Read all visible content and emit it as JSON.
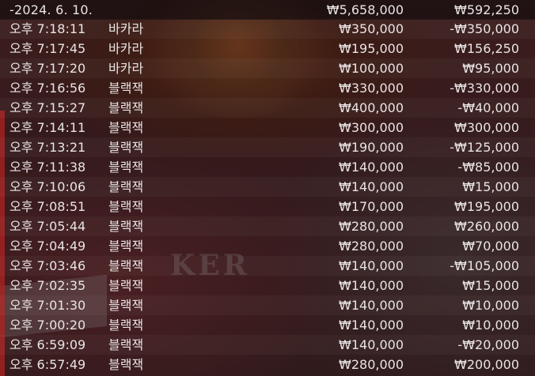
{
  "summary": {
    "date": "-2024. 6. 10.",
    "total_bet": "₩5,658,000",
    "total_result": "₩592,250"
  },
  "rows": [
    {
      "time": "오후 7:18:11",
      "game": "바카라",
      "bet": "₩350,000",
      "result": "-₩350,000"
    },
    {
      "time": "오후 7:17:45",
      "game": "바카라",
      "bet": "₩195,000",
      "result": "₩156,250"
    },
    {
      "time": "오후 7:17:20",
      "game": "바카라",
      "bet": "₩100,000",
      "result": "₩95,000"
    },
    {
      "time": "오후 7:16:56",
      "game": "블랙잭",
      "bet": "₩330,000",
      "result": "-₩330,000"
    },
    {
      "time": "오후 7:15:27",
      "game": "블랙잭",
      "bet": "₩400,000",
      "result": "-₩40,000"
    },
    {
      "time": "오후 7:14:11",
      "game": "블랙잭",
      "bet": "₩300,000",
      "result": "₩300,000"
    },
    {
      "time": "오후 7:13:21",
      "game": "블랙잭",
      "bet": "₩190,000",
      "result": "-₩125,000"
    },
    {
      "time": "오후 7:11:38",
      "game": "블랙잭",
      "bet": "₩140,000",
      "result": "-₩85,000"
    },
    {
      "time": "오후 7:10:06",
      "game": "블랙잭",
      "bet": "₩140,000",
      "result": "₩15,000"
    },
    {
      "time": "오후 7:08:51",
      "game": "블랙잭",
      "bet": "₩170,000",
      "result": "₩195,000"
    },
    {
      "time": "오후 7:05:44",
      "game": "블랙잭",
      "bet": "₩280,000",
      "result": "₩260,000"
    },
    {
      "time": "오후 7:04:49",
      "game": "블랙잭",
      "bet": "₩280,000",
      "result": "₩70,000"
    },
    {
      "time": "오후 7:03:46",
      "game": "블랙잭",
      "bet": "₩140,000",
      "result": "-₩105,000"
    },
    {
      "time": "오후 7:02:35",
      "game": "블랙잭",
      "bet": "₩140,000",
      "result": "₩15,000"
    },
    {
      "time": "오후 7:01:30",
      "game": "블랙잭",
      "bet": "₩140,000",
      "result": "₩10,000"
    },
    {
      "time": "오후 7:00:20",
      "game": "블랙잭",
      "bet": "₩140,000",
      "result": "₩10,000"
    },
    {
      "time": "오후 6:59:09",
      "game": "블랙잭",
      "bet": "₩140,000",
      "result": "-₩20,000"
    },
    {
      "time": "오후 6:57:49",
      "game": "블랙잭",
      "bet": "₩280,000",
      "result": "₩200,000"
    }
  ],
  "background": {
    "watermark": "KER"
  },
  "colors": {
    "text": "#e9e4e4",
    "header_bg": "#160e10",
    "accent_edge": "#b22222"
  }
}
